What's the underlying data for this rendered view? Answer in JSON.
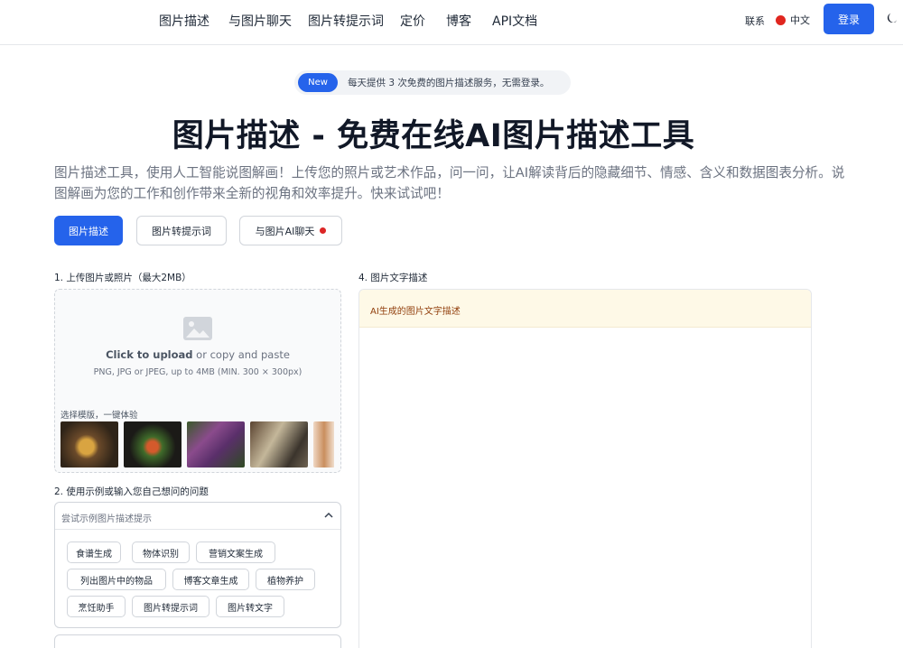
{
  "header": {
    "nav": [
      "图片描述",
      "与图片聊天",
      "图片转提示词",
      "定价",
      "博客",
      "API文档"
    ],
    "contact": "联系",
    "language": "中文",
    "login": "登录"
  },
  "badge": {
    "tag": "New",
    "text": "每天提供 3 次免费的图片描述服务，无需登录。"
  },
  "hero": {
    "title": "图片描述 - 免费在线AI图片描述工具",
    "subtitle": "图片描述工具，使用人工智能说图解画！上传您的照片或艺术作品，问一问，让AI解读背后的隐藏细节、情感、含义和数据图表分析。说图解画为您的工作和创作带来全新的视角和效率提升。快来试试吧！"
  },
  "tabs": [
    "图片描述",
    "图片转提示词",
    "与图片AI聊天"
  ],
  "upload": {
    "label": "1. 上传图片或照片（最大2MB）",
    "click_text": "Click to upload",
    "or_text": " or copy and paste",
    "hint": "PNG, JPG or JPEG, up to 4MB (MIN. 300 × 300px)",
    "templates_label": "选择模版，一键体验"
  },
  "prompt": {
    "label": "2. 使用示例或输入您自己想问的问题",
    "placeholder": "尝试示例图片描述提示",
    "chips": [
      "食谱生成",
      "物体识别",
      "营销文案生成",
      "列出图片中的物品",
      "博客文章生成",
      "植物养护",
      "烹饪助手",
      "图片转提示词",
      "图片转文字"
    ]
  },
  "description": {
    "label": "4. 图片文字描述",
    "placeholder": "AI生成的图片文字描述"
  },
  "colors": {
    "accent": "#2563eb",
    "desc_header_bg": "#fef9e7",
    "desc_header_text": "#92400e",
    "notification_dot": "#dc2626"
  }
}
